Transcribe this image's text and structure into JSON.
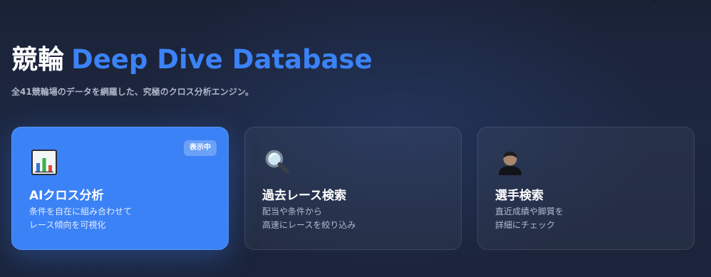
{
  "hero": {
    "title_jp": "競輪",
    "title_en": "Deep Dive Database",
    "subtitle": "全41競輪場のデータを網羅した、究極のクロス分析エンジン。"
  },
  "cards": [
    {
      "icon": "bar-chart-icon",
      "title": "AIクロス分析",
      "desc_line1": "条件を自在に組み合わせて",
      "desc_line2": "レース傾向を可視化",
      "badge": "表示中",
      "active": true
    },
    {
      "icon": "magnifier-icon",
      "title": "過去レース検索",
      "desc_line1": "配当や条件から",
      "desc_line2": "高速にレースを絞り込み",
      "active": false
    },
    {
      "icon": "person-icon",
      "title": "選手検索",
      "desc_line1": "直近成績や脚質を",
      "desc_line2": "詳細にチェック",
      "active": false
    }
  ],
  "colors": {
    "accent": "#3b82f6",
    "background": "#1b2439",
    "subtitle": "#aeb7c8"
  }
}
